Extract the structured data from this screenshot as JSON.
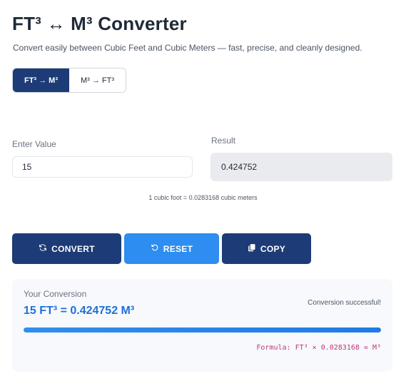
{
  "header": {
    "title": "FT³ ↔ M³ Converter",
    "subtitle": "Convert easily between Cubic Feet and Cubic Meters — fast, precise, and cleanly designed."
  },
  "mode_toggle": {
    "options": [
      {
        "label": "FT³ → M³",
        "active": true
      },
      {
        "label": "M³ → FT³",
        "active": false
      }
    ]
  },
  "form": {
    "input_label": "Enter Value",
    "input_value": "15",
    "result_label": "Result",
    "result_value": "0.424752",
    "hint": "1 cubic foot = 0.0283168 cubic meters"
  },
  "actions": {
    "convert_label": "CONVERT",
    "convert_icon": "refresh-icon",
    "reset_label": "RESET",
    "reset_icon": "undo-icon",
    "copy_label": "COPY",
    "copy_icon": "copy-icon"
  },
  "summary": {
    "label": "Your Conversion",
    "result_text": "15 FT³ = 0.424752 M³",
    "status": "Conversion successful!",
    "progress_percent": 100,
    "formula": "Formula: FT³ × 0.0283168 = M³"
  },
  "colors": {
    "primary_dark": "#1d3b76",
    "primary_blue": "#2e8df0",
    "result_text": "#1e6fd9",
    "formula_text": "#c0367a"
  }
}
